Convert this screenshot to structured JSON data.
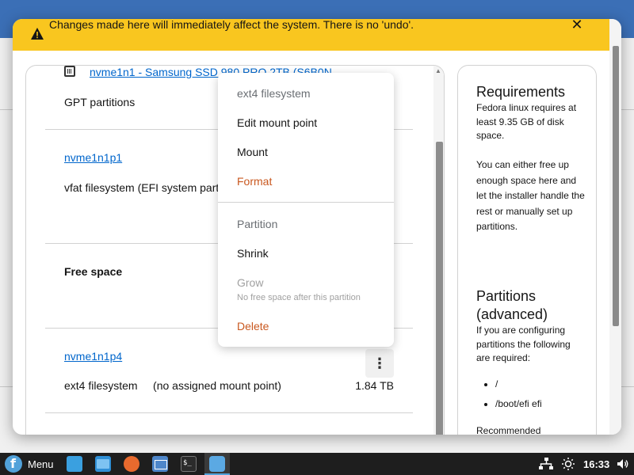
{
  "alert": {
    "text": "Changes made here will immediately affect the system. There is no 'undo'."
  },
  "disks": {
    "disk_link": "nvme1n1 - Samsung SSD 980 PRO 2TB (S6B0N",
    "disk_desc": "GPT partitions",
    "partition1": {
      "name": "nvme1n1p1",
      "desc": "vfat filesystem (EFI system part"
    },
    "free_space": "Free space",
    "partition4": {
      "name": "nvme1n1p4",
      "desc": "ext4 filesystem     (no assigned mount point)",
      "size": "1.84 TB"
    }
  },
  "menu": {
    "header": "ext4 filesystem",
    "edit_mount_point": "Edit mount point",
    "mount": "Mount",
    "format": "Format",
    "partition_header": "Partition",
    "shrink": "Shrink",
    "grow": "Grow",
    "grow_note": "No free space after this partition",
    "delete": "Delete"
  },
  "sidebar": {
    "requirements_title": "Requirements",
    "requirements_text": "Fedora linux requires at least 9.35 GB of disk space.",
    "requirements_text2": "You can either free up enough space here and let the installer handle the rest or manually set up partitions.",
    "partitions_title": "Partitions (advanced)",
    "partitions_text": "If you are configuring partitions the following are required:",
    "required": [
      "/",
      "/boot/efi efi"
    ],
    "recommended": "Recommended"
  },
  "taskbar": {
    "menu_label": "Menu",
    "clock": "16:33"
  },
  "colors": {
    "alert_bg": "#f9c61f",
    "link": "#0066cc",
    "danger": "#c9581f",
    "taskbar_bg": "#1e1e1e"
  }
}
